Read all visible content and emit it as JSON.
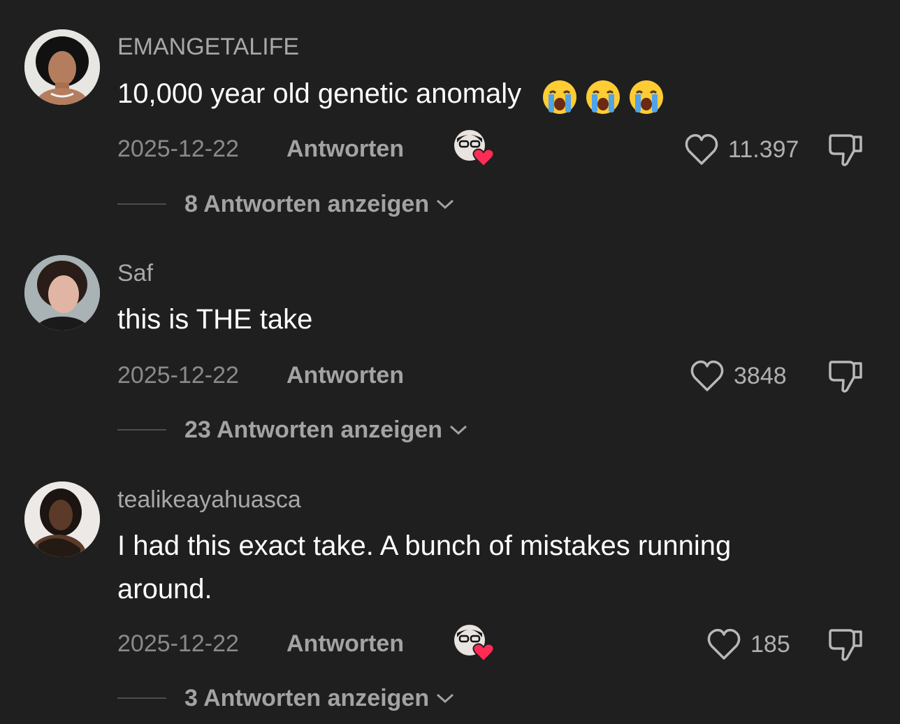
{
  "comments": [
    {
      "username": "EMANGETALIFE",
      "text": "10,000 year old genetic anomaly",
      "emojis": [
        "loudly-crying-face",
        "loudly-crying-face",
        "loudly-crying-face"
      ],
      "date": "2025-12-22",
      "reply_label": "Antworten",
      "creator_liked": true,
      "like_count": "11.397",
      "view_replies": "8 Antworten anzeigen"
    },
    {
      "username": "Saf",
      "text": "this is THE take",
      "emojis": [],
      "date": "2025-12-22",
      "reply_label": "Antworten",
      "creator_liked": false,
      "like_count": "3848",
      "view_replies": "23 Antworten anzeigen"
    },
    {
      "username": "tealikeayahuasca",
      "text_line1": "I had this exact take. A bunch of mistakes running",
      "text_line2": "around.",
      "emojis": [],
      "date": "2025-12-22",
      "reply_label": "Antworten",
      "creator_liked": true,
      "like_count": "185",
      "view_replies": "3 Antworten anzeigen"
    }
  ],
  "icons": {
    "like": "heart-outline-icon",
    "dislike": "thumbs-down-icon",
    "chevron": "chevron-down-icon",
    "creator_like": "creator-liked-heart-icon"
  },
  "colors": {
    "background": "#1f1f1f",
    "creator_heart": "#fe2c55",
    "secondary_text": "#a3a3a3"
  }
}
